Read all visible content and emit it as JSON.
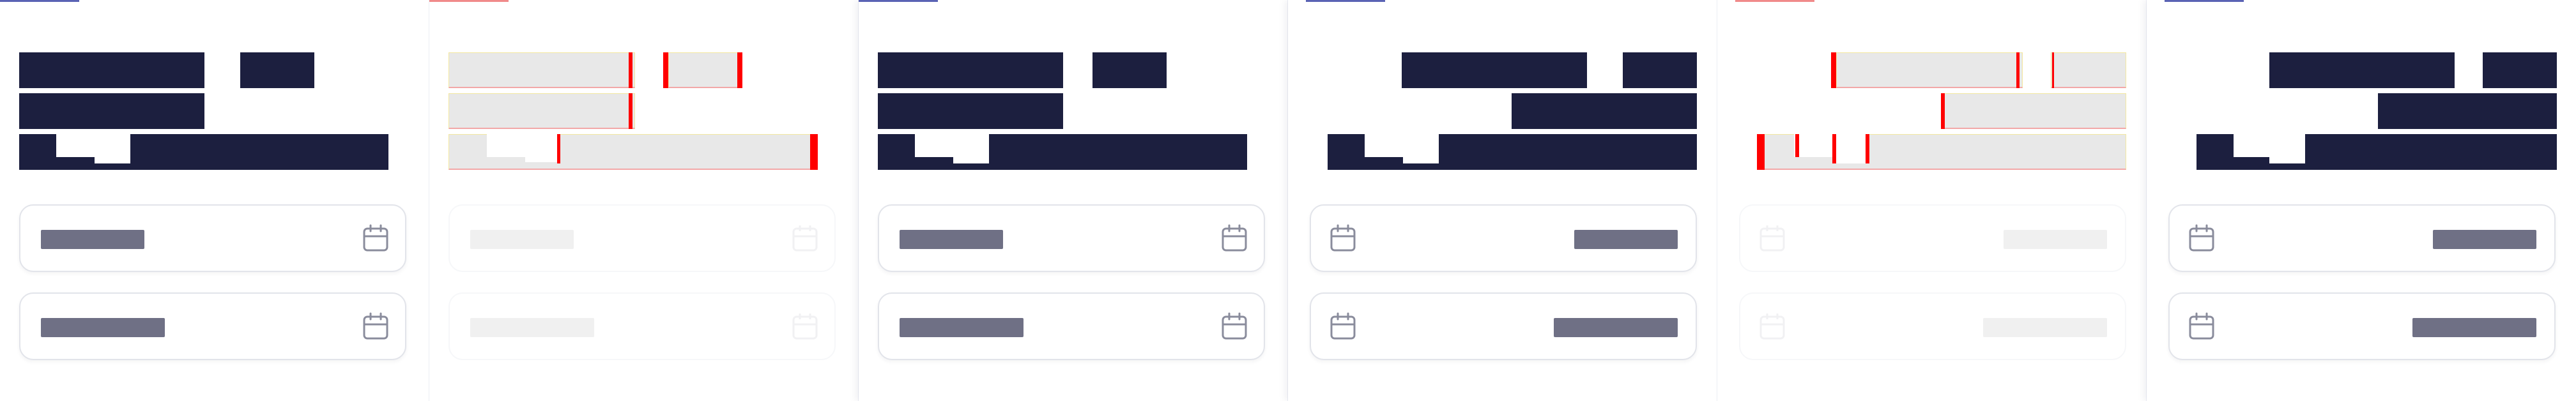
{
  "app": {
    "title": ""
  },
  "panels": [
    {
      "variant": "ltr",
      "fields": [
        {
          "value": "",
          "placeholder": ""
        },
        {
          "value": "",
          "placeholder": ""
        }
      ]
    },
    {
      "variant": "ltr-debug",
      "fields": [
        {
          "value": "",
          "placeholder": ""
        },
        {
          "value": "",
          "placeholder": ""
        }
      ]
    },
    {
      "variant": "ltr",
      "fields": [
        {
          "value": "",
          "placeholder": ""
        },
        {
          "value": "",
          "placeholder": ""
        }
      ]
    },
    {
      "variant": "rtl",
      "fields": [
        {
          "value": "",
          "placeholder": ""
        },
        {
          "value": "",
          "placeholder": ""
        }
      ]
    },
    {
      "variant": "rtl-debug",
      "fields": [
        {
          "value": "",
          "placeholder": ""
        },
        {
          "value": "",
          "placeholder": ""
        }
      ]
    },
    {
      "variant": "rtl",
      "fields": [
        {
          "value": "",
          "placeholder": ""
        },
        {
          "value": "",
          "placeholder": ""
        }
      ]
    }
  ],
  "icons": {
    "field": "calendar-icon"
  },
  "colors": {
    "title_text": "#1c1f3f",
    "field_text": "#6f7085",
    "field_border": "#e2e4ea",
    "debug_fill": "#e8e8e8",
    "debug_mark": "#ff0000",
    "tab_accent": "#5a63b4"
  }
}
